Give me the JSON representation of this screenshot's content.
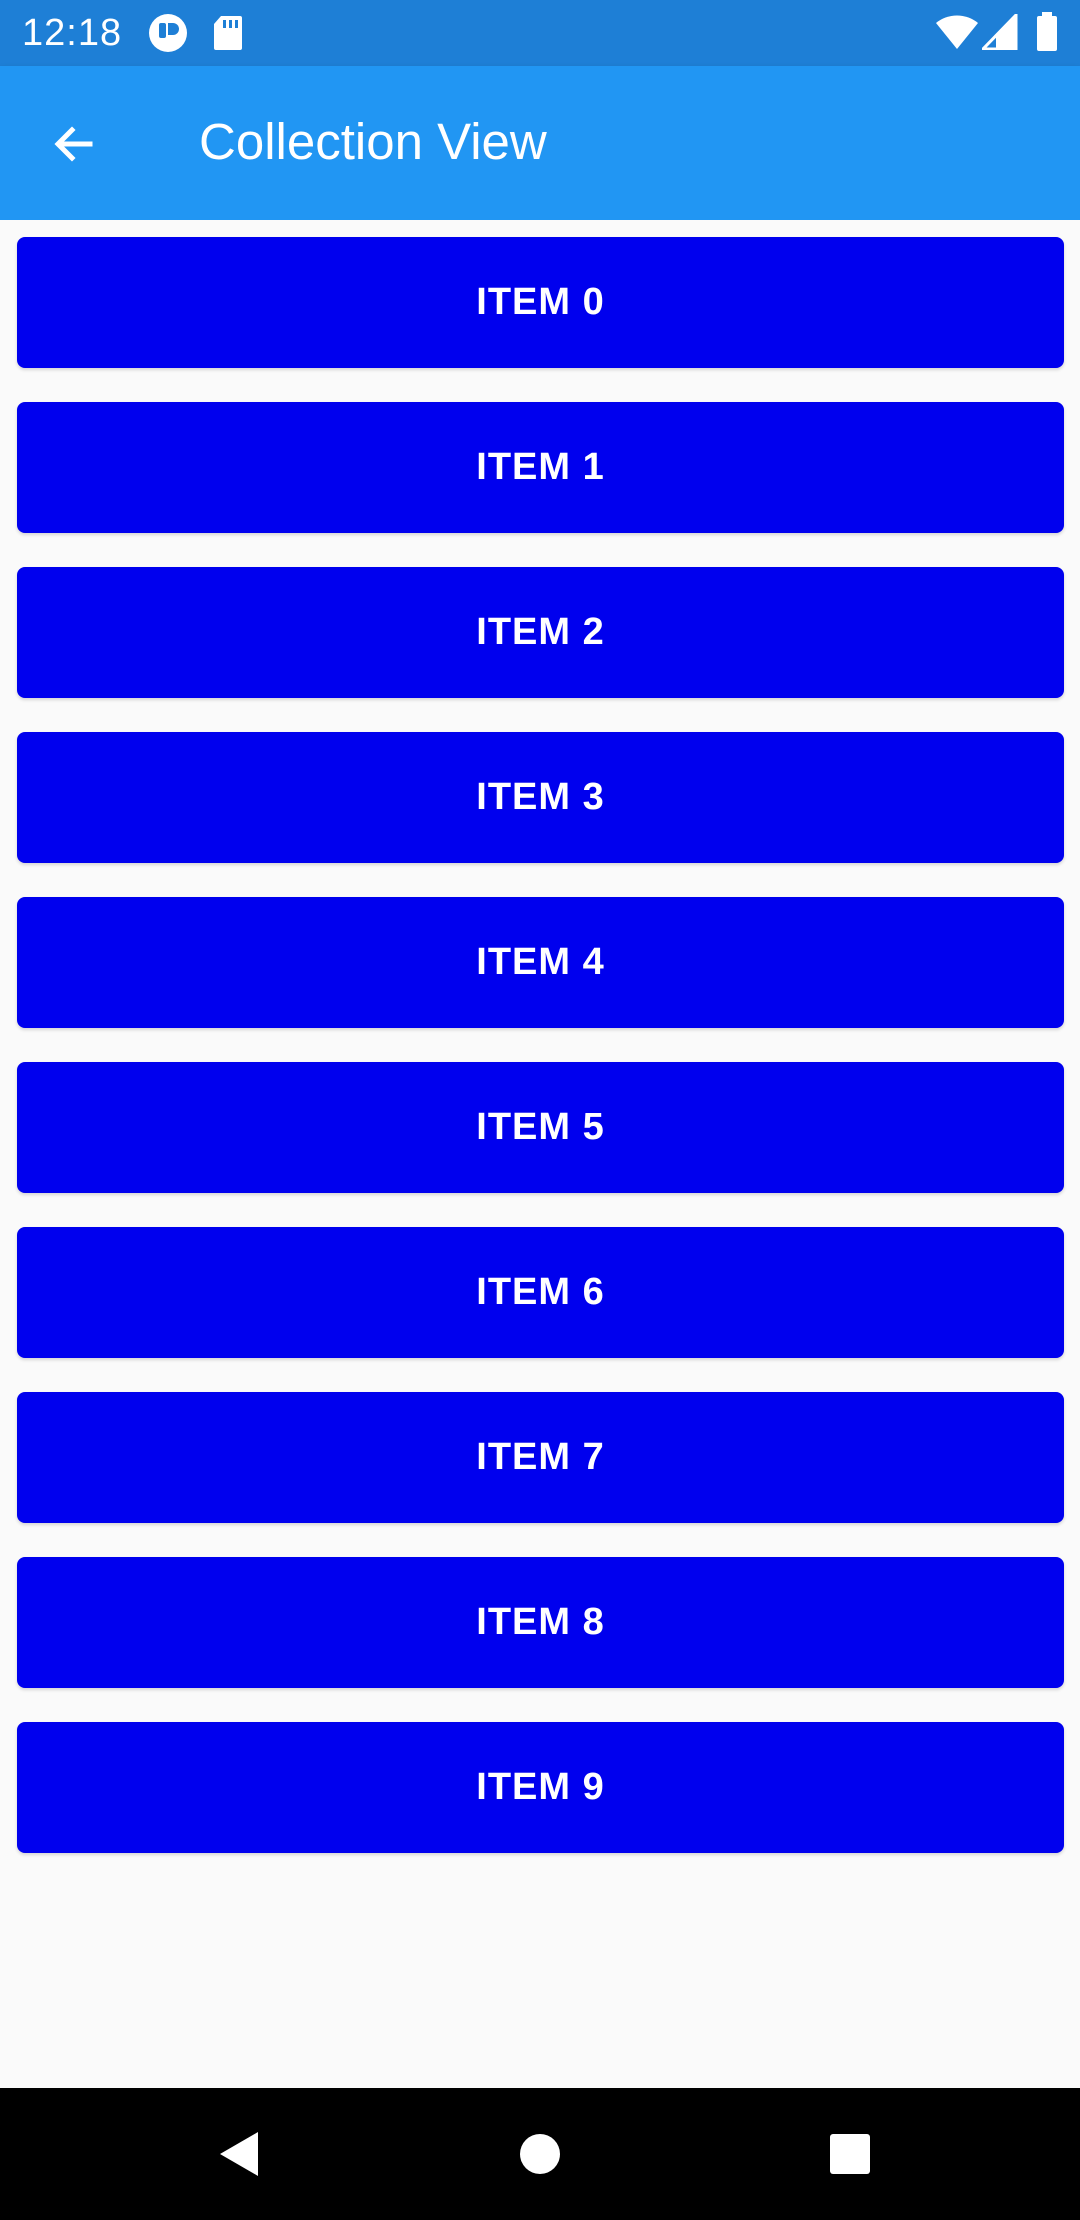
{
  "status_bar": {
    "time": "12:18",
    "icons": [
      "notification-app-icon",
      "sd-card-icon",
      "wifi-icon",
      "cell-signal-icon",
      "battery-icon"
    ]
  },
  "app_bar": {
    "title": "Collection View",
    "back_icon": "arrow-left-icon",
    "background": "#2196f3"
  },
  "items": [
    {
      "label": "ITEM 0"
    },
    {
      "label": "ITEM 1"
    },
    {
      "label": "ITEM 2"
    },
    {
      "label": "ITEM 3"
    },
    {
      "label": "ITEM 4"
    },
    {
      "label": "ITEM 5"
    },
    {
      "label": "ITEM 6"
    },
    {
      "label": "ITEM 7"
    },
    {
      "label": "ITEM 8"
    },
    {
      "label": "ITEM 9"
    }
  ],
  "colors": {
    "status_bar": "#1e7fd6",
    "item_background": "#0000ee",
    "item_text": "#ffffff",
    "page_background": "#fafafa",
    "nav_bar": "#000000"
  },
  "nav_bar": {
    "icons": [
      "back-triangle-icon",
      "home-circle-icon",
      "recents-square-icon"
    ]
  }
}
